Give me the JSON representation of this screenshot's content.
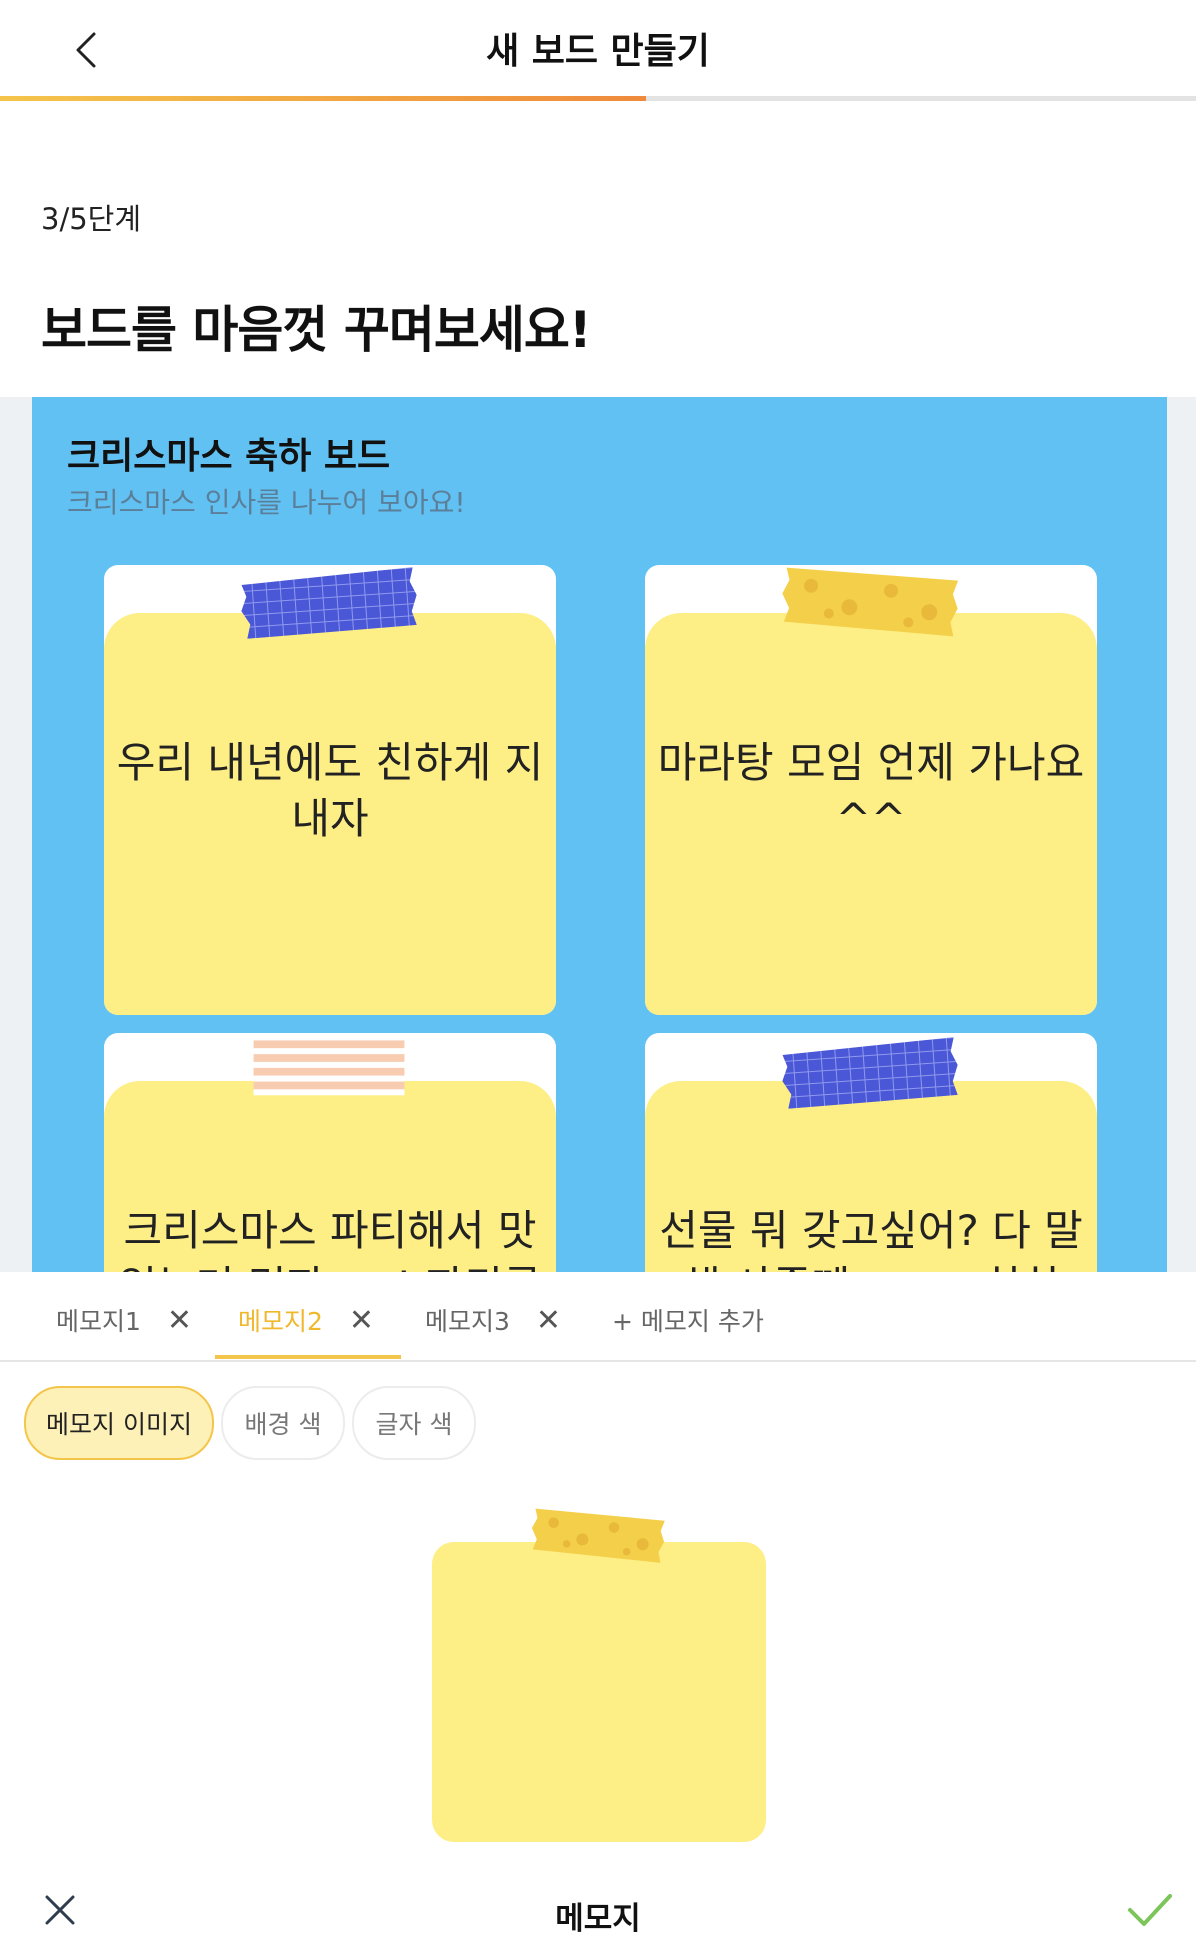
{
  "header": {
    "title": "새 보드 만들기"
  },
  "progress": {
    "current_step": 3,
    "total_steps": 5,
    "fraction": 0.6
  },
  "step_label": "3/5단계",
  "heading": "보드를 마음껏 꾸며보세요!",
  "board": {
    "title": "크리스마스 축하 보드",
    "subtitle": "크리스마스 인사를 나누어 보아요!",
    "background_color": "#62c1f3",
    "notes": [
      {
        "text": "우리 내년에도 친하게 지내자",
        "tape": "blue-grid",
        "note_color": "#fdee86"
      },
      {
        "text": "마라탕 모임 언제 가나요 ^^",
        "tape": "yellow-dots",
        "note_color": "#fdee86"
      },
      {
        "text": "크리스마스 파티해서 맛있는거 먹자~~! 파티룸",
        "tape": "peach-stripes",
        "note_color": "#fdee86"
      },
      {
        "text": "선물 뭐 갖고싶어? 다 말해 사줄께~~ ~ 히히",
        "tape": "blue-grid",
        "note_color": "#fdee86"
      }
    ]
  },
  "tabs": [
    {
      "label": "메모지1",
      "active": false
    },
    {
      "label": "메모지2",
      "active": true
    },
    {
      "label": "메모지3",
      "active": false
    }
  ],
  "add_tab_label": "+ 메모지 추가",
  "options": [
    {
      "label": "메모지 이미지",
      "active": true
    },
    {
      "label": "배경 색",
      "active": false
    },
    {
      "label": "글자 색",
      "active": false
    }
  ],
  "preview_note": {
    "tape": "yellow-dots",
    "color": "#fdee86"
  },
  "bottom_bar": {
    "title": "메모지"
  },
  "colors": {
    "accent": "#f4c54b",
    "accent_dark": "#ef8a3c",
    "check": "#7cc55a"
  }
}
